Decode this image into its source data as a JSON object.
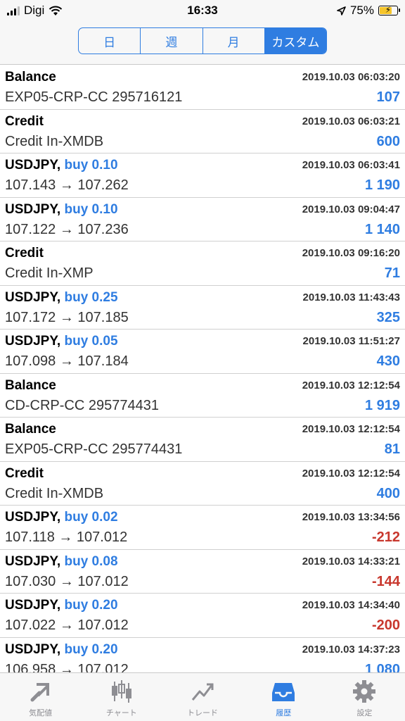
{
  "status": {
    "carrier": "Digi",
    "time": "16:33",
    "battery": "75%",
    "battery_level": 0.75
  },
  "segments": [
    {
      "label": "日",
      "active": false
    },
    {
      "label": "週",
      "active": false
    },
    {
      "label": "月",
      "active": false
    },
    {
      "label": "カスタム",
      "active": true
    }
  ],
  "rows": [
    {
      "title": "Balance",
      "side": "",
      "time": "2019.10.03 06:03:20",
      "desc": "EXP05-CRP-CC 295716121",
      "amount": "107",
      "negative": false
    },
    {
      "title": "Credit",
      "side": "",
      "time": "2019.10.03 06:03:21",
      "desc": "Credit In-XMDB",
      "amount": "600",
      "negative": false
    },
    {
      "title": "USDJPY,",
      "side": "buy 0.10",
      "time": "2019.10.03 06:03:41",
      "desc": "107.143 → 107.262",
      "amount": "1 190",
      "negative": false
    },
    {
      "title": "USDJPY,",
      "side": "buy 0.10",
      "time": "2019.10.03 09:04:47",
      "desc": "107.122 → 107.236",
      "amount": "1 140",
      "negative": false
    },
    {
      "title": "Credit",
      "side": "",
      "time": "2019.10.03 09:16:20",
      "desc": "Credit In-XMP",
      "amount": "71",
      "negative": false
    },
    {
      "title": "USDJPY,",
      "side": "buy 0.25",
      "time": "2019.10.03 11:43:43",
      "desc": "107.172 → 107.185",
      "amount": "325",
      "negative": false
    },
    {
      "title": "USDJPY,",
      "side": "buy 0.05",
      "time": "2019.10.03 11:51:27",
      "desc": "107.098 → 107.184",
      "amount": "430",
      "negative": false
    },
    {
      "title": "Balance",
      "side": "",
      "time": "2019.10.03 12:12:54",
      "desc": "CD-CRP-CC 295774431",
      "amount": "1 919",
      "negative": false
    },
    {
      "title": "Balance",
      "side": "",
      "time": "2019.10.03 12:12:54",
      "desc": "EXP05-CRP-CC 295774431",
      "amount": "81",
      "negative": false
    },
    {
      "title": "Credit",
      "side": "",
      "time": "2019.10.03 12:12:54",
      "desc": "Credit In-XMDB",
      "amount": "400",
      "negative": false
    },
    {
      "title": "USDJPY,",
      "side": "buy 0.02",
      "time": "2019.10.03 13:34:56",
      "desc": "107.118 → 107.012",
      "amount": "-212",
      "negative": true
    },
    {
      "title": "USDJPY,",
      "side": "buy 0.08",
      "time": "2019.10.03 14:33:21",
      "desc": "107.030 → 107.012",
      "amount": "-144",
      "negative": true
    },
    {
      "title": "USDJPY,",
      "side": "buy 0.20",
      "time": "2019.10.03 14:34:40",
      "desc": "107.022 → 107.012",
      "amount": "-200",
      "negative": true
    },
    {
      "title": "USDJPY,",
      "side": "buy 0.20",
      "time": "2019.10.03 14:37:23",
      "desc": "106.958 → 107.012",
      "amount": "1 080",
      "negative": false
    }
  ],
  "tabs": [
    {
      "label": "気配値",
      "icon": "quotes-arrows-icon",
      "active": false
    },
    {
      "label": "チャート",
      "icon": "candlestick-chart-icon",
      "active": false
    },
    {
      "label": "トレード",
      "icon": "trade-trend-icon",
      "active": false
    },
    {
      "label": "履歴",
      "icon": "history-inbox-icon",
      "active": true
    },
    {
      "label": "設定",
      "icon": "settings-gear-icon",
      "active": false
    }
  ],
  "colors": {
    "accent": "#2f7de1",
    "negative": "#c8372d",
    "inactive": "#8e8e93"
  }
}
